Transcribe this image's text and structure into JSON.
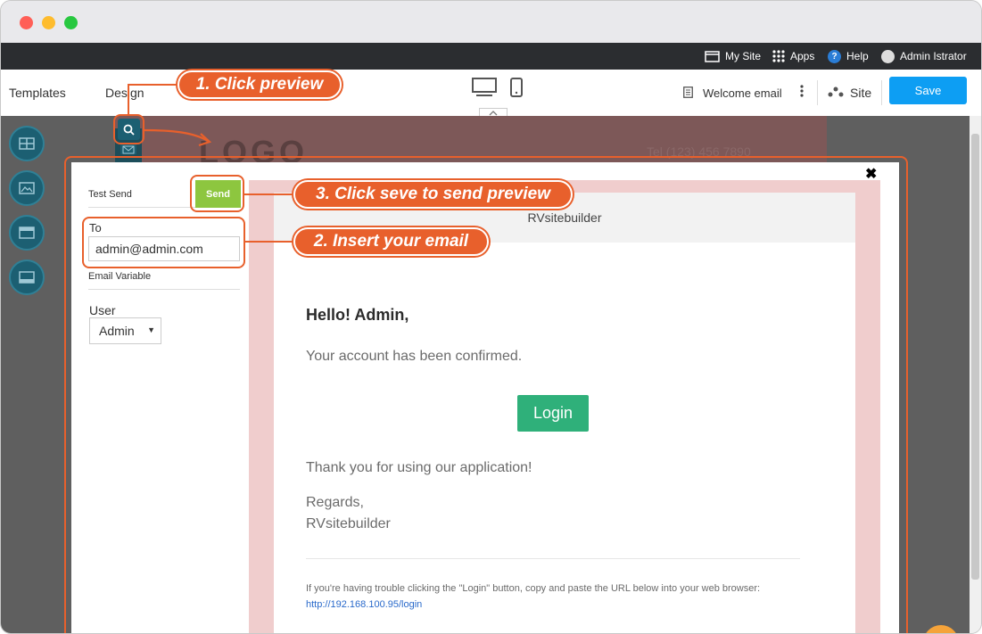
{
  "topbar": {
    "my_site": "My Site",
    "apps": "Apps",
    "help": "Help",
    "user": "Admin Istrator"
  },
  "toolbar": {
    "templates": "Templates",
    "design": "Design",
    "template_name": "Welcome email",
    "site": "Site",
    "save": "Save"
  },
  "background_page": {
    "logo": "LOGO",
    "tel": "Tel (123) 456 7890"
  },
  "test_send": {
    "title": "Test Send",
    "send_button": "Send",
    "to_label": "To",
    "to_value": "admin@admin.com",
    "email_variable": "Email Variable",
    "user_label": "User",
    "user_selected": "Admin"
  },
  "email": {
    "header": "RVsitebuilder",
    "greeting": "Hello! Admin,",
    "confirm": "Your account has been confirmed.",
    "login_button": "Login",
    "thanks": "Thank you for using our application!",
    "regards": "Regards,",
    "signature": "RVsitebuilder",
    "trouble_text": "If you're having trouble clicking the \"Login\" button, copy and paste the URL below into your web browser:",
    "url": "http://192.168.100.95/login"
  },
  "callouts": {
    "step1": "1. Click preview",
    "step2": "2. Insert your email",
    "step3": "3. Click seve to send preview"
  },
  "colors": {
    "accent_orange": "#e8602c",
    "save_blue": "#0d9ef3",
    "send_green": "#8dc63f",
    "login_green": "#2fb07a",
    "topbar_dark": "#2b2d30"
  }
}
